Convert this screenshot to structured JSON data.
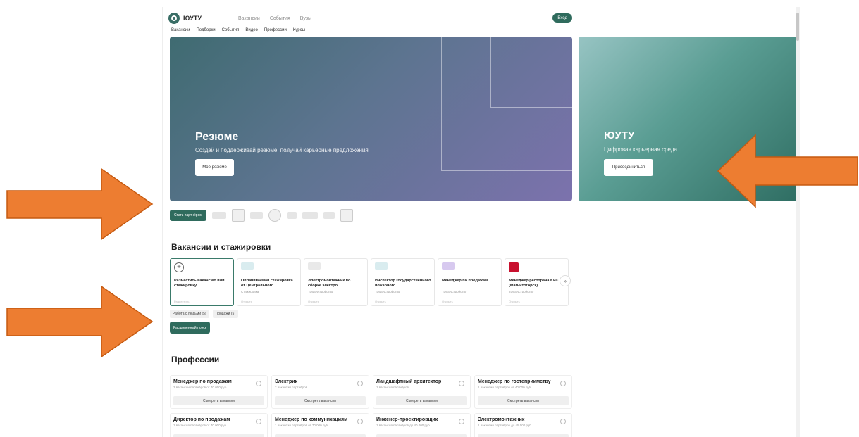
{
  "header": {
    "logo_text": "ЮУТУ",
    "top_nav": [
      "Вакансии",
      "События",
      "Вузы"
    ],
    "login_label": "Вход"
  },
  "sub_nav": [
    "Вакансии",
    "Подборки",
    "События",
    "Видео",
    "Профессии",
    "Курсы"
  ],
  "hero_main": {
    "title": "Резюме",
    "subtitle": "Создай и поддерживай резюме, получай карьерные предложения",
    "button_label": "Моё резюме"
  },
  "hero_side": {
    "title": "ЮУТУ",
    "subtitle": "Цифровая карьерная среда",
    "button_label": "Присоединиться"
  },
  "partners": {
    "button_label": "Стать партнёром"
  },
  "vacancies": {
    "section_title": "Вакансии и стажировки",
    "cards": [
      {
        "title": "Разместить вакансию или стажировку",
        "sub": "",
        "foot": "Разместить"
      },
      {
        "title": "Оплачиваемая стажировка от Центрального...",
        "sub": "Стажировка",
        "foot": "Открыть"
      },
      {
        "title": "Электромонтажник по сборке электро...",
        "sub": "Трудоустройство",
        "foot": "Открыть"
      },
      {
        "title": "Инспектор государственного пожарного...",
        "sub": "Трудоустройство",
        "foot": "Открыть"
      },
      {
        "title": "Менеджер по продажам",
        "sub": "Трудоустройство",
        "foot": "Открыть"
      },
      {
        "title": "Менеджер ресторана KFC (Магнитогорск)",
        "sub": "Трудоустройство",
        "foot": "Открыть"
      }
    ],
    "chips": [
      "Работа с людьми (5)",
      "Продажи (5)"
    ],
    "advanced_label": "Расширенный поиск"
  },
  "professions": {
    "section_title": "Профессии",
    "button_label": "Смотреть вакансии",
    "items": [
      {
        "title": "Менеджер по продажам",
        "sub": "3 вакансии партнёров от 70 000 руб"
      },
      {
        "title": "Электрик",
        "sub": "2 вакансии партнёров"
      },
      {
        "title": "Ландшафтный архитектор",
        "sub": "1 вакансия партнёров"
      },
      {
        "title": "Менеджер по гостеприимству",
        "sub": "1 вакансия партнёров от 40 000 руб"
      },
      {
        "title": "Директор по продажам",
        "sub": "1 вакансия партнёров от 70 000 руб"
      },
      {
        "title": "Менеджер по коммуникациям",
        "sub": "1 вакансия партнёров от 70 000 руб"
      },
      {
        "title": "Инженер-проектировщик",
        "sub": "1 вакансия партнёров до 40 000 руб"
      },
      {
        "title": "Электромонтажник",
        "sub": "1 вакансия партнёров до 45 000 руб"
      }
    ]
  },
  "colors": {
    "accent": "#2f6b5d",
    "arrow": "#ed7d31",
    "arrow_border": "#c55a11"
  }
}
